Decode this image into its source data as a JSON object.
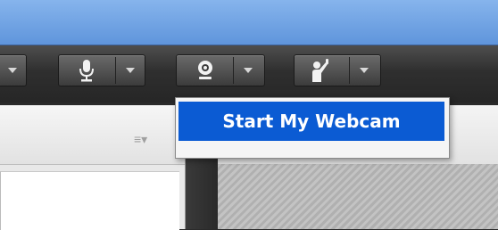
{
  "toolbar": {
    "buttons": [
      {
        "name": "previous-control",
        "icon": "dropdown-arrow-icon"
      },
      {
        "name": "microphone",
        "icon": "microphone-icon"
      },
      {
        "name": "webcam",
        "icon": "webcam-icon"
      },
      {
        "name": "raise-hand",
        "icon": "raise-hand-icon"
      }
    ]
  },
  "webcam_menu": {
    "items": [
      {
        "label": "Start My Webcam"
      }
    ]
  },
  "panels": {
    "left_menu_glyph": "≡▾"
  },
  "colors": {
    "menu_highlight": "#0b5bd3",
    "top_bar": "#6fa3e6",
    "toolbar": "#333333"
  }
}
